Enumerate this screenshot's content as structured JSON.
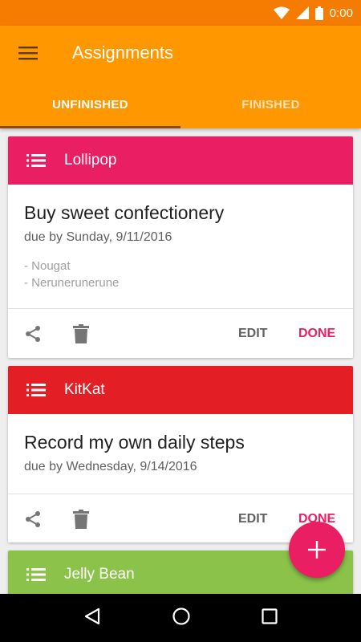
{
  "status_bar": {
    "time": "0:00"
  },
  "app_bar": {
    "title": "Assignments"
  },
  "tabs": [
    {
      "label": "UNFINISHED",
      "active": true
    },
    {
      "label": "FINISHED",
      "active": false
    }
  ],
  "cards": [
    {
      "category": "Lollipop",
      "color": "#E91E63",
      "title": "Buy sweet confectionery",
      "due": "due by Sunday, 9/11/2016",
      "notes": [
        "- Nougat",
        "- Nerunerunerune"
      ],
      "edit_label": "EDIT",
      "done_label": "DONE"
    },
    {
      "category": "KitKat",
      "color": "#E31E24",
      "title": "Record my own daily steps",
      "due": "due by Wednesday, 9/14/2016",
      "notes": [],
      "edit_label": "EDIT",
      "done_label": "DONE"
    },
    {
      "category": "Jelly Bean",
      "color": "#8BC34A"
    }
  ],
  "fab": {
    "icon": "plus-icon"
  },
  "colors": {
    "status_bar": "#F57C00",
    "app_bar": "#FF9800",
    "accent": "#E91E63"
  }
}
